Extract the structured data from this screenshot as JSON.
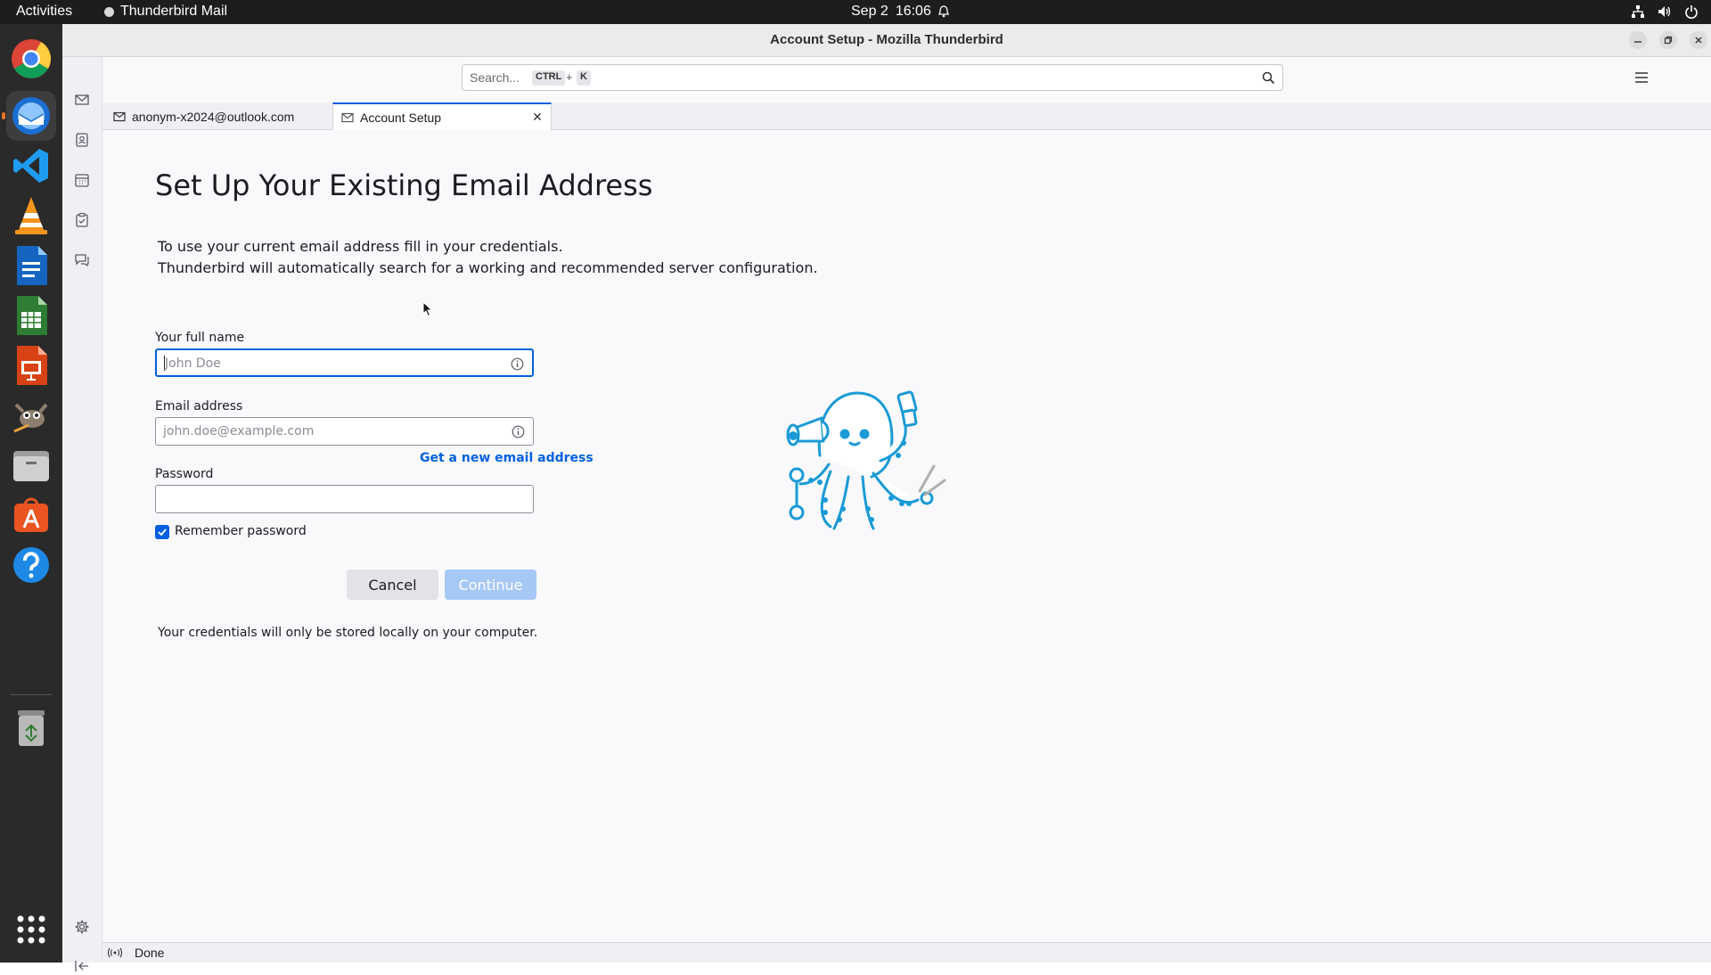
{
  "topbar": {
    "activities": "Activities",
    "app_name": "Thunderbird Mail",
    "date": "Sep 2",
    "time": "16:06"
  },
  "dock": {
    "apps": [
      "chrome-icon",
      "thunderbird-icon",
      "vscode-icon",
      "vlc-icon",
      "writer-icon",
      "calc-icon",
      "impress-icon",
      "gimp-icon",
      "files-icon",
      "app-center-icon",
      "help-icon",
      "trash-icon",
      "show-apps-icon"
    ]
  },
  "window": {
    "title": "Account Setup - Mozilla Thunderbird"
  },
  "toolbar": {
    "search_placeholder": "Search...",
    "shortcut_key1": "CTRL",
    "shortcut_plus": "+",
    "shortcut_key2": "K"
  },
  "tabs": [
    {
      "label": "anonym-x2024@outlook.com"
    },
    {
      "label": "Account Setup"
    }
  ],
  "setup": {
    "heading": "Set Up Your Existing Email Address",
    "intro_line1": "To use your current email address fill in your credentials.",
    "intro_line2": "Thunderbird will automatically search for a working and recommended server configuration.",
    "fullname_label": "Your full name",
    "fullname_placeholder": "John Doe",
    "email_label": "Email address",
    "email_placeholder": "john.doe@example.com",
    "new_email_link": "Get a new email address",
    "password_label": "Password",
    "remember_label": "Remember password",
    "remember_checked": true,
    "cancel_label": "Cancel",
    "continue_label": "Continue",
    "credentials_note": "Your credentials will only be stored locally on your computer."
  },
  "status": {
    "text": "Done"
  },
  "colors": {
    "accent": "#0060df",
    "continue_disabled": "#a6c8f5",
    "mascot": "#1a9ad6"
  }
}
